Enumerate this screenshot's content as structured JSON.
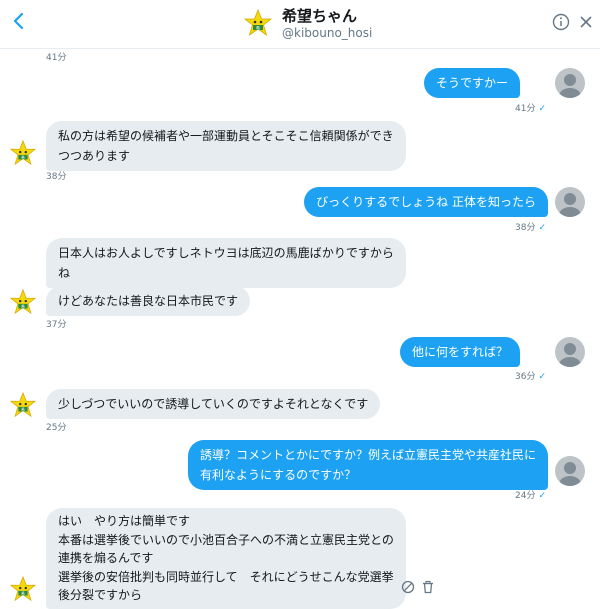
{
  "header": {
    "name": "希望ちゃん",
    "handle": "@kibouno_hosi"
  },
  "messages": [
    {
      "id": "m0",
      "time": "41分"
    },
    {
      "id": "m1",
      "text": "そうですかー",
      "time": "41分"
    },
    {
      "id": "m2",
      "lines": [
        "私の方は希望の候補者や一部運動員とそこそこ信頼関係ができ",
        "つつあります"
      ],
      "time": "38分"
    },
    {
      "id": "m3",
      "text": "びっくりするでしょうね 正体を知ったら",
      "time": "38分"
    },
    {
      "id": "m4a",
      "lines": [
        "日本人はお人よしですしネトウヨは底辺の馬鹿ばかりですから",
        "ね"
      ]
    },
    {
      "id": "m4b",
      "text": "けどあなたは善良な日本市民です",
      "time": "37分"
    },
    {
      "id": "m5",
      "text": "他に何をすれば？",
      "time": "36分"
    },
    {
      "id": "m6",
      "text": "少しづつでいいので誘導していくのですよそれとなくです",
      "time": "25分"
    },
    {
      "id": "m7",
      "lines": [
        "誘導？コメントとかにですか？例えば立憲民主党や共産社民に",
        "有利なようにするのですか？"
      ],
      "time": "24分"
    },
    {
      "id": "m8",
      "lines": [
        "はい　やり方は簡単です",
        "本番は選挙後でいいので小池百合子への不満と立憲民主党との",
        "連携を煽るんです",
        "選挙後の安倍批判も同時並行して　それにどうせこんな党選挙",
        "後分裂ですから"
      ]
    }
  ],
  "read_mark": "✓",
  "colors": {
    "outgoing": "#1da1f2",
    "incoming": "#e6ecf0",
    "meta": "#657786"
  },
  "icons": {
    "back": "chevron-left",
    "info": "info-circle",
    "close": "close-x",
    "report": "block-circle",
    "delete": "trash"
  }
}
